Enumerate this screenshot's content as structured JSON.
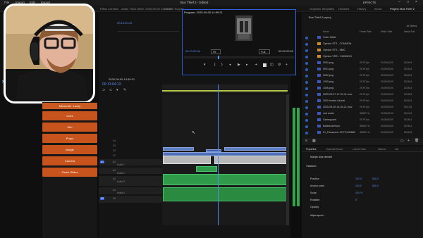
{
  "menu": {
    "items": [
      "File",
      "Import",
      "Edit",
      "Export"
    ],
    "title": "Bus Thief 2 - Edited"
  },
  "panels": {
    "effects": "EFFECTS"
  },
  "source_tabs": [
    "Effect Controls",
    "Audio Track Mixer: 2025-09-05 14:59:21",
    "Lumetri Scopes"
  ],
  "source": {
    "timecode": "00:13:00:34"
  },
  "program": {
    "title": "Program: 2025-09-05 14:59:21",
    "timecode": "00:13:00:34",
    "fit": "Fit",
    "quality": "Full",
    "duration": "00:00:29:29",
    "bottom_timecode": "00:13:04:13"
  },
  "project": {
    "tabs": [
      "Graphics Templates",
      "Libraries",
      "History",
      "Arrow",
      "Project: Bus Thief 2"
    ],
    "bin": "Bus Thief 2.prproj",
    "count": "16 Items",
    "headers": [
      "Name",
      "Frame Rate",
      "Media Start",
      "Media End"
    ],
    "rows": [
      {
        "name": "Color Matte",
        "rate": "",
        "start": "",
        "end": "",
        "folder": false
      },
      {
        "name": "Opinion STS - COMMON",
        "rate": "",
        "start": "",
        "end": "",
        "folder": true
      },
      {
        "name": "Opinion STS - MMC",
        "rate": "",
        "start": "",
        "end": "",
        "folder": true
      },
      {
        "name": "Opinion VRS - COMMON",
        "rate": "",
        "start": "",
        "end": "",
        "folder": true
      },
      {
        "name": "0000.png",
        "rate": "29.97 fps",
        "start": "00;00;00;00",
        "end": "00;00;4",
        "folder": false
      },
      {
        "name": "0001.png",
        "rate": "29.97 fps",
        "start": "00;00;00;00",
        "end": "00;00;4",
        "folder": false
      },
      {
        "name": "0002.png",
        "rate": "29.97 fps",
        "start": "00;00;00;00",
        "end": "00;00;4",
        "folder": false
      },
      {
        "name": "1005.png",
        "rate": "29.97 fps",
        "start": "00;00;00;00",
        "end": "00;00;4",
        "folder": false
      },
      {
        "name": "1006.png",
        "rate": "29.97 fps",
        "start": "00;00;00;00",
        "end": "00;00;4",
        "folder": false
      },
      {
        "name": "2025-09-07 17-02-41.mov",
        "rate": "29.97 fps",
        "start": "00;00;00;00",
        "end": "00;05;3",
        "folder": false
      },
      {
        "name": "3000 render tutorial",
        "rate": "29.97 fps",
        "start": "00;00;00;00",
        "end": "00;00;2",
        "folder": false
      },
      {
        "name": "2025-09-05 14-59-21.mov",
        "rate": "29.97 fps",
        "start": "00;00;00;00",
        "end": "00;12;5",
        "folder": false
      },
      {
        "name": "end audio",
        "rate": "48000 Hz",
        "start": "00;00;00;00",
        "end": "00;01;3",
        "folder": false
      },
      {
        "name": "Gameguard",
        "rate": "29.97 fps",
        "start": "00;00;00;00",
        "end": "00;00;1",
        "folder": false
      },
      {
        "name": "Beatbuckerson",
        "rate": "48000 Hz",
        "start": "00;00;00;00",
        "end": "00;00;1",
        "folder": false
      },
      {
        "name": "01_Panasonic 09 TG100880",
        "rate": "48000 Hz",
        "start": "00;00;00;00",
        "end": "00;00;5",
        "folder": false
      }
    ]
  },
  "properties": {
    "tabs": [
      "Properties",
      "Essential Sound",
      "Lumetri Color",
      "Markers",
      "Info"
    ],
    "selection": "Multiple clips selected",
    "section": "Transform",
    "rows": [
      {
        "k": "Position",
        "v1": "192.0",
        "v2": "540.0"
      },
      {
        "k": "Anchor point",
        "v1": "192.0",
        "v2": "540.0"
      },
      {
        "k": "Scale",
        "v1": "100 %",
        "v2": ""
      },
      {
        "k": "Rotation",
        "v1": "0 °",
        "v2": ""
      },
      {
        "k": "Opacity",
        "v1": "",
        "v2": ""
      }
    ],
    "adjust": "Adjust speed..."
  },
  "timeline": {
    "seq": "2025-09-05 14:59:21",
    "timecode": "00:13:04:13",
    "video_tracks": [
      "V4",
      "V3",
      "V2",
      "V1"
    ],
    "audio_tracks": [
      "A1",
      "A2",
      "A3",
      "A4",
      "A5"
    ],
    "track_names": {
      "A1": "Audio 1",
      "A2": "Audio 2",
      "A3": "Audio 3",
      "A4": "Audio 4"
    }
  },
  "label_buttons": [
    "Minecraft - Lucky",
    "Goes",
    "Hilo",
    "Props",
    "Bridge",
    "Camera",
    "Game Slides"
  ],
  "colors": {
    "accent": "#2e5fd6",
    "label": "#c7541c",
    "video": "#5f7fc3",
    "audio": "#2f9a4a"
  }
}
